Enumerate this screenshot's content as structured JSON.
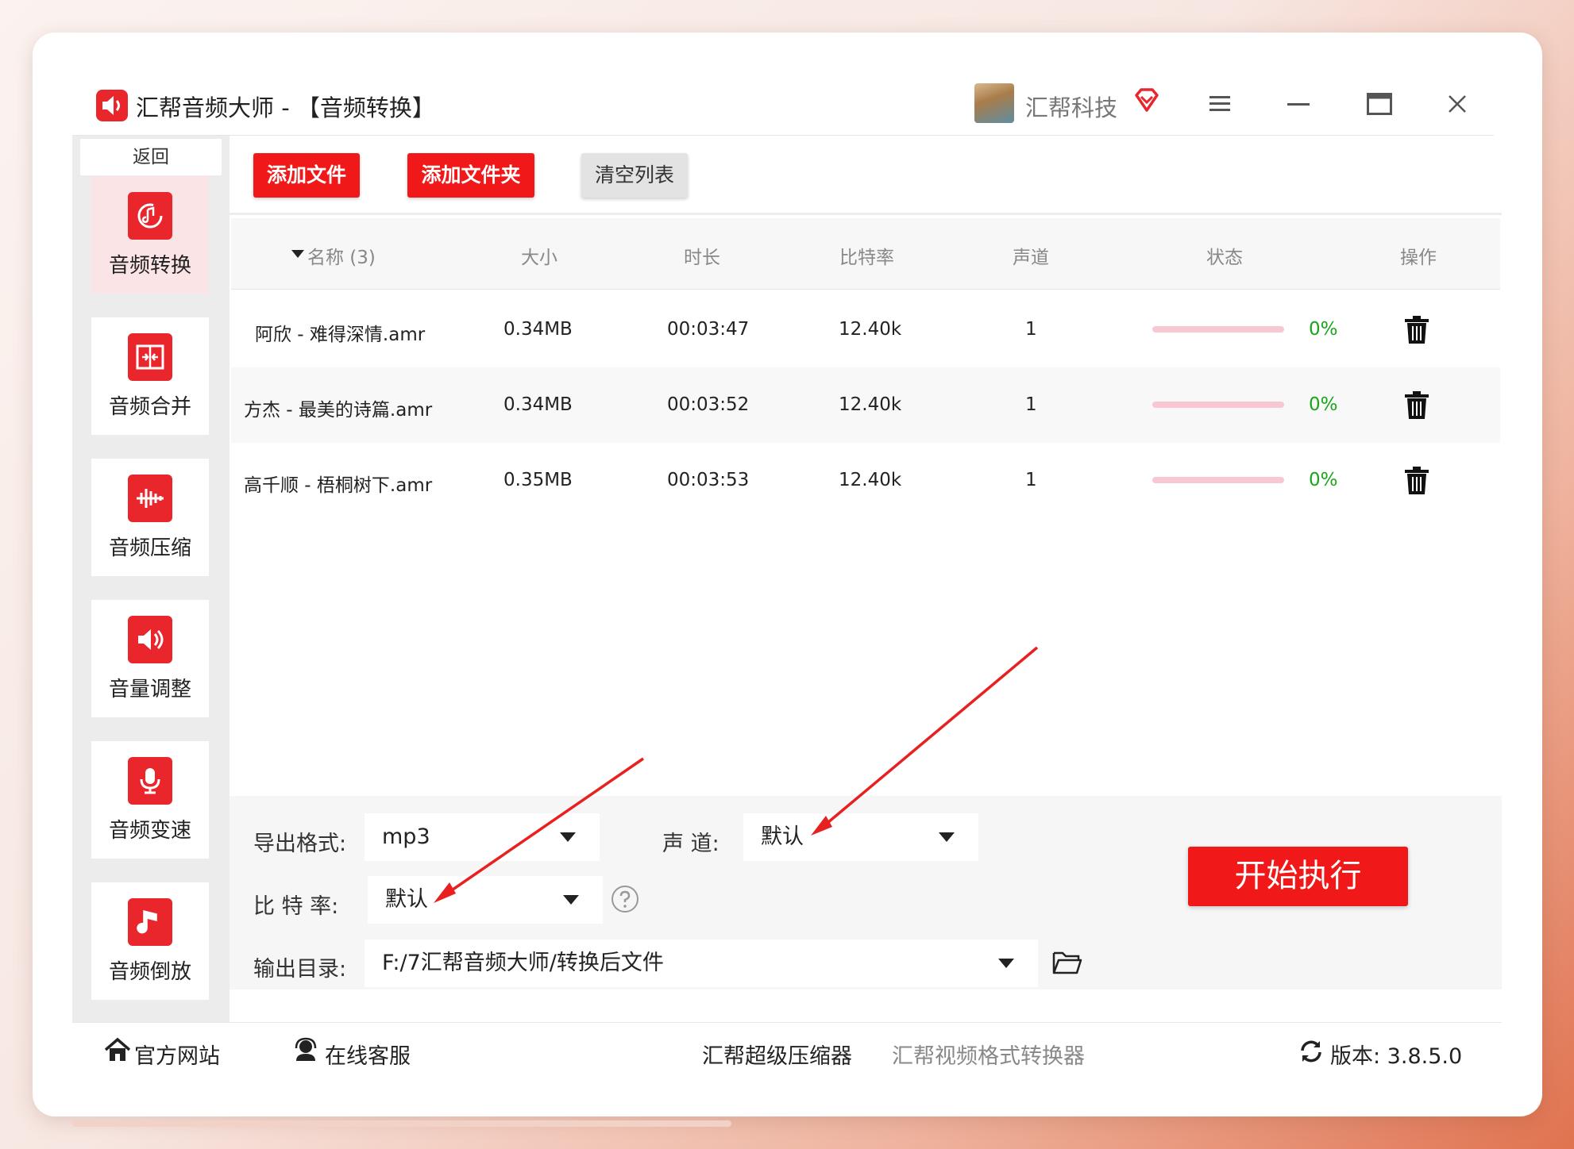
{
  "window": {
    "title": "汇帮音频大师  - 【音频转换】",
    "user_name": "汇帮科技"
  },
  "sidebar": {
    "back_label": "返回",
    "items": [
      {
        "label": "音频转换",
        "icon": "audio-convert-icon",
        "active": true
      },
      {
        "label": "音频合并",
        "icon": "audio-merge-icon",
        "active": false
      },
      {
        "label": "音频压缩",
        "icon": "audio-compress-icon",
        "active": false
      },
      {
        "label": "音量调整",
        "icon": "volume-adjust-icon",
        "active": false
      },
      {
        "label": "音频变速",
        "icon": "audio-speed-icon",
        "active": false
      },
      {
        "label": "音频倒放",
        "icon": "audio-reverse-icon",
        "active": false
      }
    ]
  },
  "toolbar": {
    "add_file": "添加文件",
    "add_folder": "添加文件夹",
    "clear_list": "清空列表"
  },
  "table": {
    "headers": {
      "name": "名称 (3)",
      "size": "大小",
      "duration": "时长",
      "bitrate": "比特率",
      "channel": "声道",
      "status": "状态",
      "action": "操作"
    },
    "rows": [
      {
        "name": "阿欣 - 难得深情.amr",
        "size": "0.34MB",
        "duration": "00:03:47",
        "bitrate": "12.40k",
        "channel": "1",
        "progress": "0%"
      },
      {
        "name": "方杰 - 最美的诗篇.amr",
        "size": "0.34MB",
        "duration": "00:03:52",
        "bitrate": "12.40k",
        "channel": "1",
        "progress": "0%"
      },
      {
        "name": "高千顺 - 梧桐树下.amr",
        "size": "0.35MB",
        "duration": "00:03:53",
        "bitrate": "12.40k",
        "channel": "1",
        "progress": "0%"
      }
    ]
  },
  "settings": {
    "format_label": "导出格式:",
    "format_value": "mp3",
    "channel_label": "声 道:",
    "channel_value": "默认",
    "bitrate_label": "比 特 率:",
    "bitrate_value": "默认",
    "output_label": "输出目录:",
    "output_value": "F:/7汇帮音频大师/转换后文件",
    "start_button": "开始执行"
  },
  "footer": {
    "website": "官方网站",
    "support": "在线客服",
    "compressor": "汇帮超级压缩器",
    "video_converter": "汇帮视频格式转换器",
    "version": "版本: 3.8.5.0"
  },
  "colors": {
    "brand_red": "#f01818",
    "progress_pink": "#f7c8d2",
    "progress_text": "#1aa41a"
  }
}
